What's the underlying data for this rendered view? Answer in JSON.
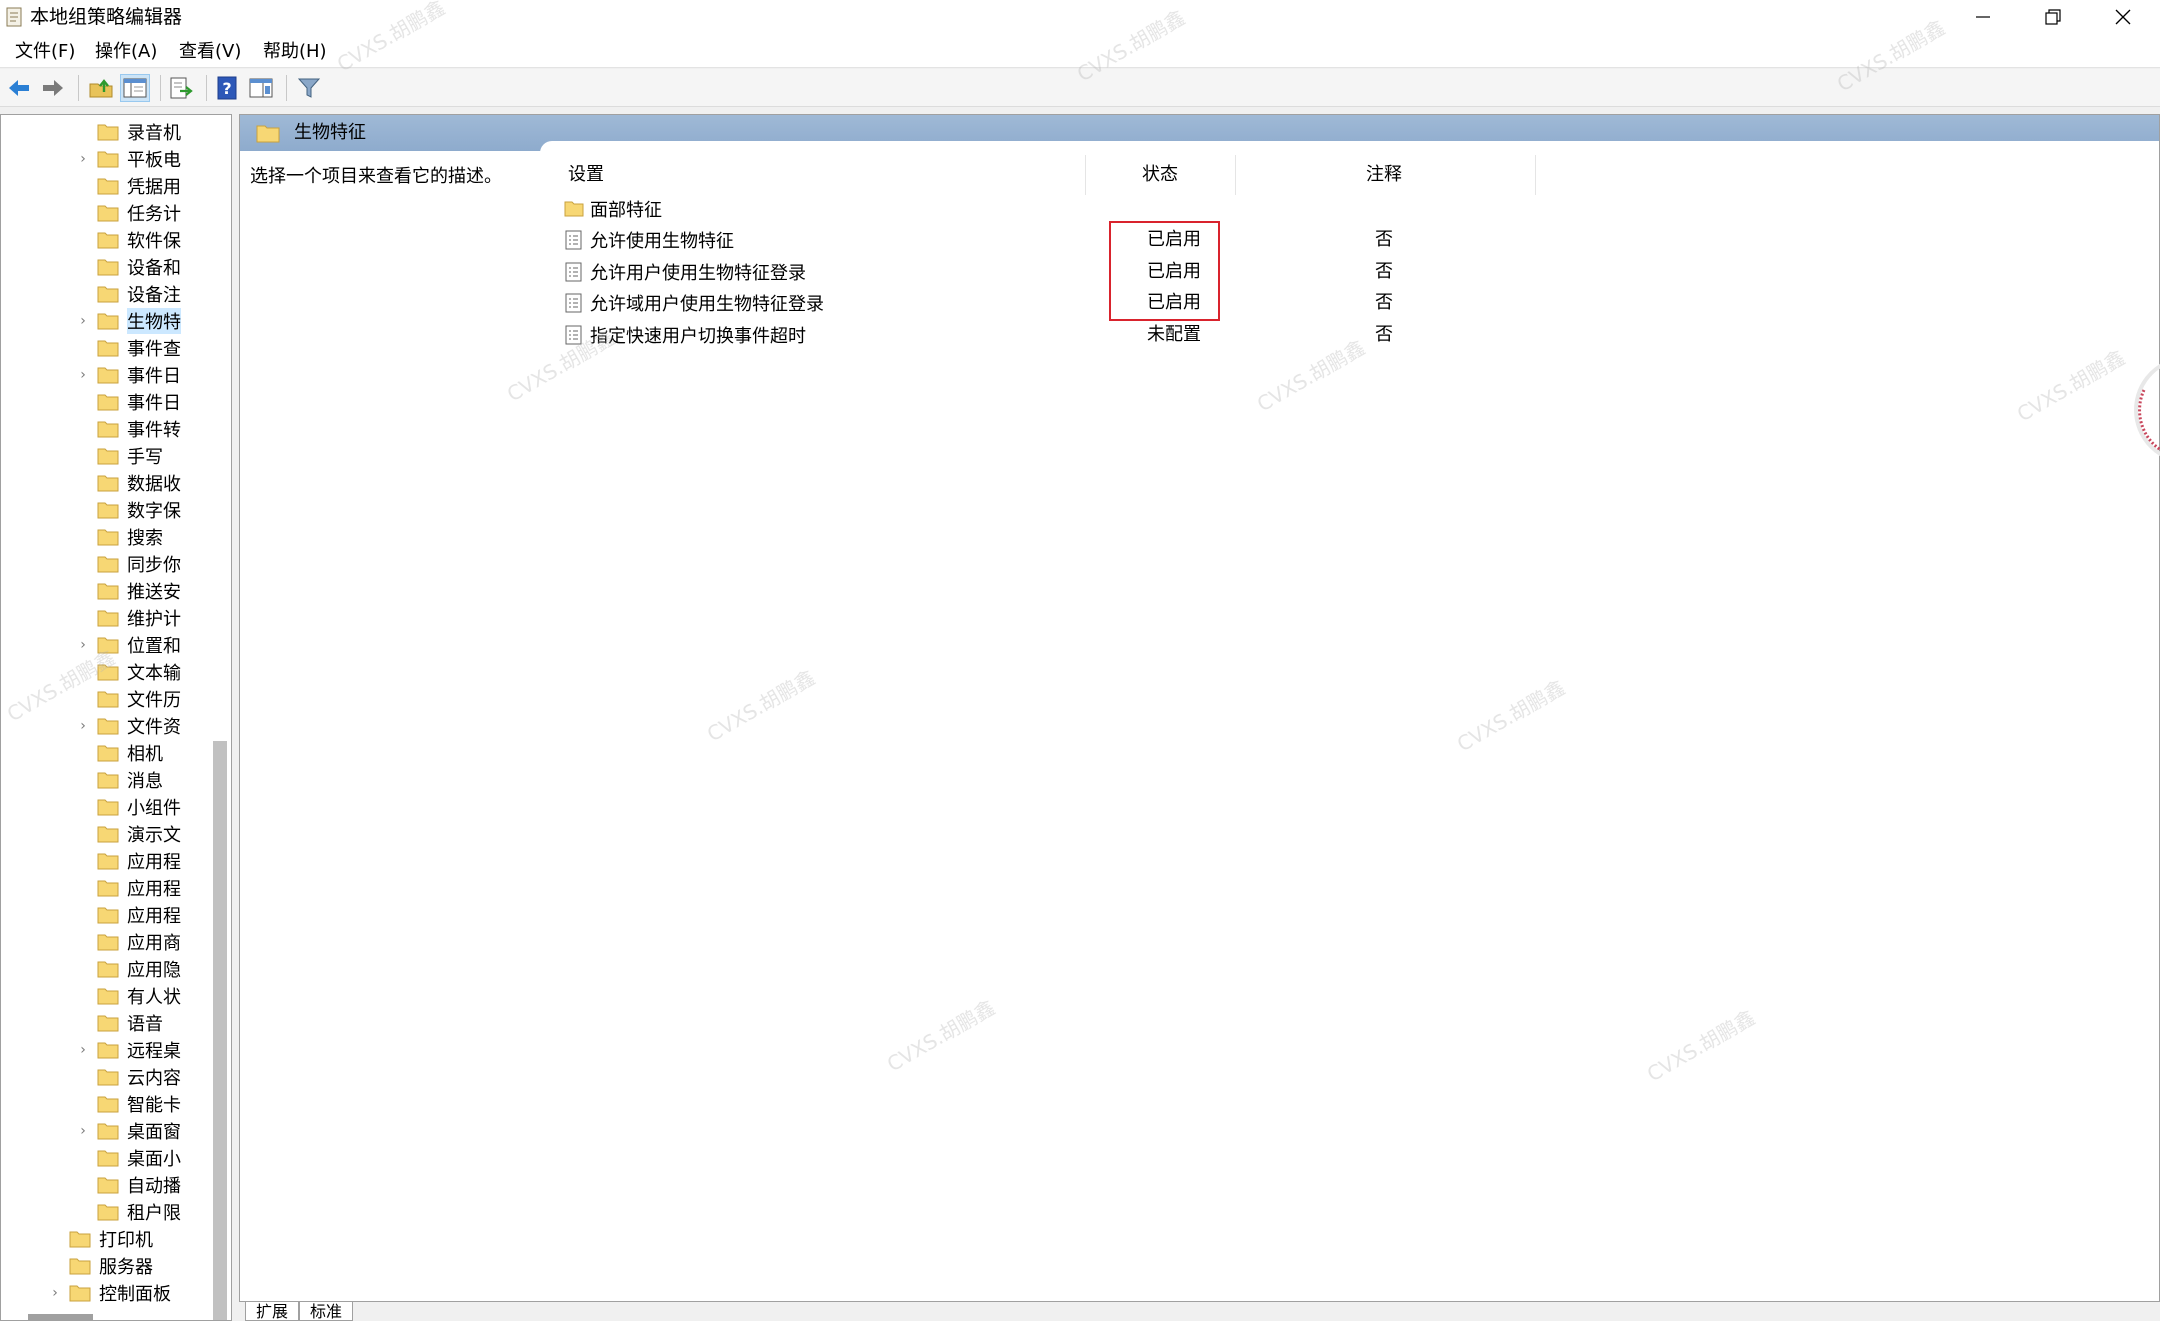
{
  "window": {
    "title": "本地组策略编辑器"
  },
  "menu": [
    "文件(F)",
    "操作(A)",
    "查看(V)",
    "帮助(H)"
  ],
  "toolbar": {
    "buttons": [
      "back-icon",
      "forward-icon",
      "up-folder-icon",
      "show-hide-tree-icon",
      "export-list-icon",
      "help-icon",
      "properties-view-icon",
      "filter-icon"
    ]
  },
  "tree": {
    "items": [
      {
        "label": "录音机",
        "expandable": false
      },
      {
        "label": "平板电",
        "expandable": true
      },
      {
        "label": "凭据用",
        "expandable": false
      },
      {
        "label": "任务计",
        "expandable": false
      },
      {
        "label": "软件保",
        "expandable": false
      },
      {
        "label": "设备和",
        "expandable": false
      },
      {
        "label": "设备注",
        "expandable": false
      },
      {
        "label": "生物特",
        "expandable": true,
        "selected": true
      },
      {
        "label": "事件查",
        "expandable": false
      },
      {
        "label": "事件日",
        "expandable": true
      },
      {
        "label": "事件日",
        "expandable": false
      },
      {
        "label": "事件转",
        "expandable": false
      },
      {
        "label": "手写",
        "expandable": false
      },
      {
        "label": "数据收",
        "expandable": false
      },
      {
        "label": "数字保",
        "expandable": false
      },
      {
        "label": "搜索",
        "expandable": false
      },
      {
        "label": "同步你",
        "expandable": false
      },
      {
        "label": "推送安",
        "expandable": false
      },
      {
        "label": "维护计",
        "expandable": false
      },
      {
        "label": "位置和",
        "expandable": true
      },
      {
        "label": "文本输",
        "expandable": false
      },
      {
        "label": "文件历",
        "expandable": false
      },
      {
        "label": "文件资",
        "expandable": true
      },
      {
        "label": "相机",
        "expandable": false
      },
      {
        "label": "消息",
        "expandable": false
      },
      {
        "label": "小组件",
        "expandable": false
      },
      {
        "label": "演示文",
        "expandable": false
      },
      {
        "label": "应用程",
        "expandable": false
      },
      {
        "label": "应用程",
        "expandable": false
      },
      {
        "label": "应用程",
        "expandable": false
      },
      {
        "label": "应用商",
        "expandable": false
      },
      {
        "label": "应用隐",
        "expandable": false
      },
      {
        "label": "有人状",
        "expandable": false
      },
      {
        "label": "语音",
        "expandable": false
      },
      {
        "label": "远程桌",
        "expandable": true
      },
      {
        "label": "云内容",
        "expandable": false
      },
      {
        "label": "智能卡",
        "expandable": false
      },
      {
        "label": "桌面窗",
        "expandable": true
      },
      {
        "label": "桌面小",
        "expandable": false
      },
      {
        "label": "自动播",
        "expandable": false
      },
      {
        "label": "租户限",
        "expandable": false
      }
    ],
    "parent_items": [
      {
        "label": "打印机",
        "expandable": false
      },
      {
        "label": "服务器",
        "expandable": false
      },
      {
        "label": "控制面板",
        "expandable": true
      }
    ]
  },
  "right_pane": {
    "header_title": "生物特征",
    "description": "选择一个项目来查看它的描述。",
    "columns": {
      "setting": "设置",
      "state": "状态",
      "comment": "注释"
    },
    "folder_row": "面部特征",
    "rows": [
      {
        "label": "允许使用生物特征",
        "state": "已启用",
        "comment": "否"
      },
      {
        "label": "允许用户使用生物特征登录",
        "state": "已启用",
        "comment": "否"
      },
      {
        "label": "允许域用户使用生物特征登录",
        "state": "已启用",
        "comment": "否"
      },
      {
        "label": "指定快速用户切换事件超时",
        "state": "未配置",
        "comment": "否"
      }
    ]
  },
  "bottom_tabs": [
    "扩展",
    "标准"
  ],
  "watermark": "CVXS.胡鹏鑫",
  "colors": {
    "highlight_box": "#d9232d",
    "pane_header": "#9fb9d6",
    "selected_tree": "#cce8ff"
  }
}
